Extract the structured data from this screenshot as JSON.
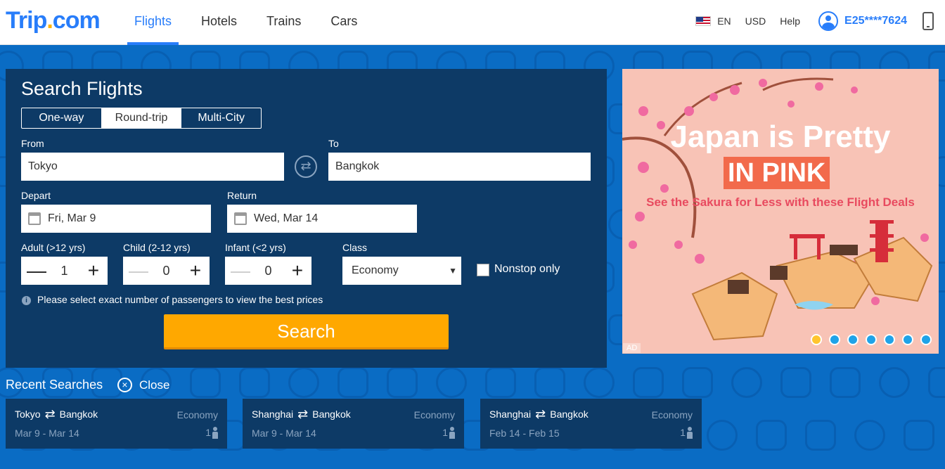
{
  "header": {
    "logo": {
      "main": "Trip",
      "dot": ".",
      "tail": "com"
    },
    "nav": [
      {
        "label": "Flights",
        "active": true
      },
      {
        "label": "Hotels"
      },
      {
        "label": "Trains"
      },
      {
        "label": "Cars"
      }
    ],
    "language": "EN",
    "currency": "USD",
    "help": "Help",
    "user": "E25****7624"
  },
  "search": {
    "title": "Search Flights",
    "trip_types": [
      "One-way",
      "Round-trip",
      "Multi-City"
    ],
    "selected_trip_type": "Round-trip",
    "from_label": "From",
    "from_value": "Tokyo",
    "to_label": "To",
    "to_value": "Bangkok",
    "depart_label": "Depart",
    "depart_value": "Fri, Mar 9",
    "return_label": "Return",
    "return_value": "Wed, Mar 14",
    "adult_label": "Adult (>12 yrs)",
    "adult_value": "1",
    "child_label": "Child (2-12 yrs)",
    "child_value": "0",
    "infant_label": "Infant (<2 yrs)",
    "infant_value": "0",
    "class_label": "Class",
    "class_value": "Economy",
    "nonstop_label": "Nonstop only",
    "info_text": "Please select exact number of passengers to view the best prices",
    "search_button": "Search",
    "glyphs": {
      "minus": "—",
      "plus": "+",
      "swap": "⇄",
      "caret": "▼",
      "info": "i"
    }
  },
  "ad": {
    "title_line1": "Japan is Pretty",
    "title_line2": "IN PINK",
    "subtitle": "See the Sakura for Less with these Flight Deals",
    "tag": "AD",
    "slide_count": 7,
    "active_slide": 1
  },
  "recent": {
    "title": "Recent Searches",
    "close_label": "Close",
    "close_glyph": "×",
    "arrow_glyph": "⇄",
    "cards": [
      {
        "from": "Tokyo",
        "to": "Bangkok",
        "class": "Economy",
        "dates": "Mar 9 - Mar 14",
        "pax": "1"
      },
      {
        "from": "Shanghai",
        "to": "Bangkok",
        "class": "Economy",
        "dates": "Mar 9 - Mar 14",
        "pax": "1"
      },
      {
        "from": "Shanghai",
        "to": "Bangkok",
        "class": "Economy",
        "dates": "Feb 14 - Feb 15",
        "pax": "1"
      }
    ]
  },
  "colors": {
    "brand": "#287dfa",
    "panel": "#0d3a66",
    "background": "#0a6cc4",
    "search_button": "#ffa800"
  }
}
